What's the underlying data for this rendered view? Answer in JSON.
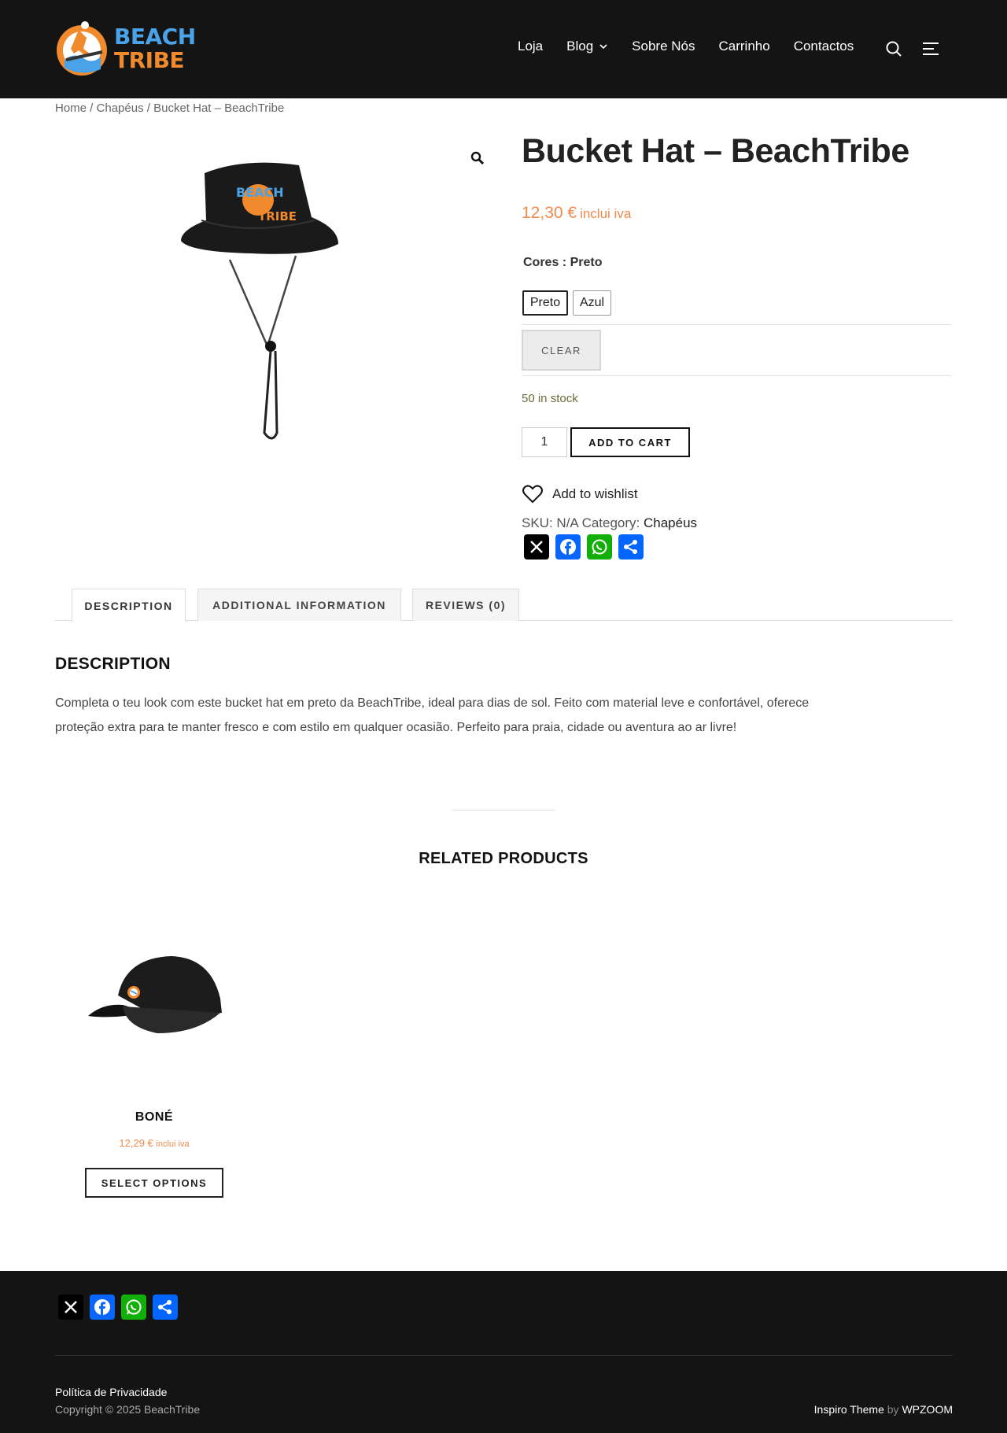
{
  "header": {
    "logo": {
      "line1": "BEACH",
      "line2": "TRIBE"
    },
    "nav": [
      {
        "label": "Loja"
      },
      {
        "label": "Blog"
      },
      {
        "label": "Sobre Nós"
      },
      {
        "label": "Carrinho"
      },
      {
        "label": "Contactos"
      }
    ],
    "icons": [
      "search-icon",
      "menu-icon"
    ]
  },
  "breadcrumb": {
    "home": "Home",
    "sep": " / ",
    "category": "Chapéus",
    "current": "Bucket Hat – BeachTribe"
  },
  "product": {
    "title": "Bucket Hat – BeachTribe",
    "price": "12,30 €",
    "price_suffix": "inclui iva",
    "attribute_label": "Cores",
    "attribute_value": "Preto",
    "swatches": [
      {
        "label": "Preto",
        "selected": true
      },
      {
        "label": "Azul",
        "selected": false
      }
    ],
    "clear_label": "CLEAR",
    "stock": "50 in stock",
    "quantity": "1",
    "add_to_cart": "ADD TO CART",
    "wishlist": "Add to wishlist",
    "sku_label": "SKU:",
    "sku_value": "N/A",
    "category_label": "Category:",
    "category_value": "Chapéus"
  },
  "tabs": [
    {
      "label": "DESCRIPTION",
      "active": true
    },
    {
      "label": "ADDITIONAL INFORMATION",
      "active": false
    },
    {
      "label": "REVIEWS (0)",
      "active": false
    }
  ],
  "description": {
    "heading": "DESCRIPTION",
    "text": "Completa o teu look com este bucket hat em preto da BeachTribe, ideal para dias de sol. Feito com material leve e confortável, oferece proteção extra para te manter fresco e com estilo em qualquer ocasião. Perfeito para praia, cidade ou aventura ao ar livre!"
  },
  "related": {
    "heading": "RELATED PRODUCTS",
    "items": [
      {
        "name": "BONÉ",
        "price": "12,29 €",
        "price_suffix": "inclui iva",
        "button": "SELECT OPTIONS"
      }
    ]
  },
  "share_icons": [
    "x-icon",
    "facebook-icon",
    "whatsapp-icon",
    "share-icon"
  ],
  "colors": {
    "x": "#000000",
    "facebook": "#0866FF",
    "whatsapp": "#12AF0A",
    "share": "#0166FF",
    "accent": "#F08A4B",
    "dark": "#141414"
  },
  "footer": {
    "privacy": "Política de Privacidade",
    "copyright": "Copyright © 2025 BeachTribe",
    "credit_theme": "Inspiro Theme",
    "credit_by": "by",
    "credit_author": "WPZOOM"
  }
}
